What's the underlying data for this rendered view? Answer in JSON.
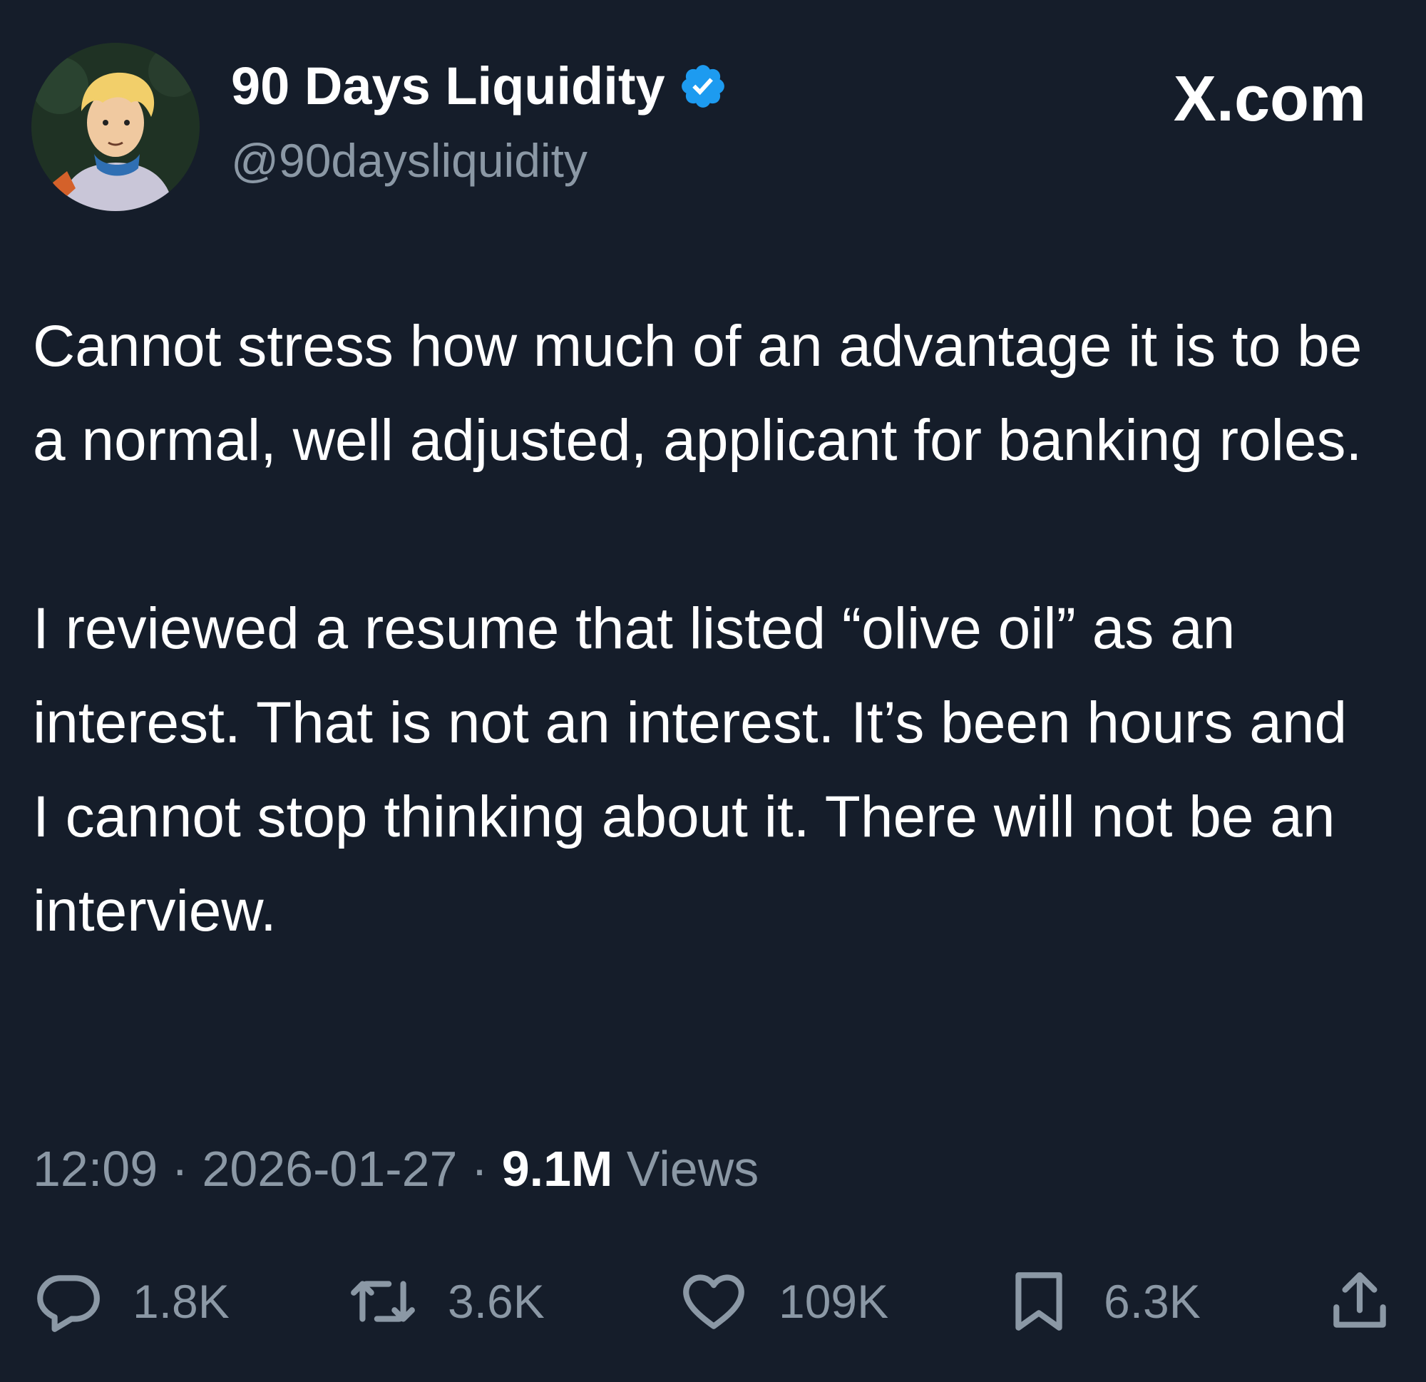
{
  "post": {
    "author": {
      "display_name": "90 Days Liquidity",
      "handle": "@90daysliquidity",
      "verified_icon": "verified-badge-icon",
      "avatar": "cartoon-avatar"
    },
    "site_label": "X.com",
    "text": {
      "paragraph_1": "Cannot stress how much of an advantage it is to be a normal, well adjusted, applicant for banking roles.",
      "paragraph_2": "I reviewed a resume that listed “olive oil” as an interest. That is not an interest. It’s been hours and I cannot stop thinking about it. There will not be an interview."
    },
    "meta": {
      "time": "12:09",
      "separator": "·",
      "date": "2026-01-27",
      "views_count": "9.1M",
      "views_label": "Views"
    },
    "actions": {
      "replies": {
        "icon": "reply-icon",
        "count": "1.8K"
      },
      "reposts": {
        "icon": "repost-icon",
        "count": "3.6K"
      },
      "likes": {
        "icon": "heart-icon",
        "count": "109K"
      },
      "bookmarks": {
        "icon": "bookmark-icon",
        "count": "6.3K"
      },
      "share": {
        "icon": "share-icon"
      }
    }
  },
  "colors": {
    "background": "#151d2a",
    "primary_text": "#ffffff",
    "secondary_text": "#8b98a5",
    "verified_blue": "#1d9bf0"
  }
}
